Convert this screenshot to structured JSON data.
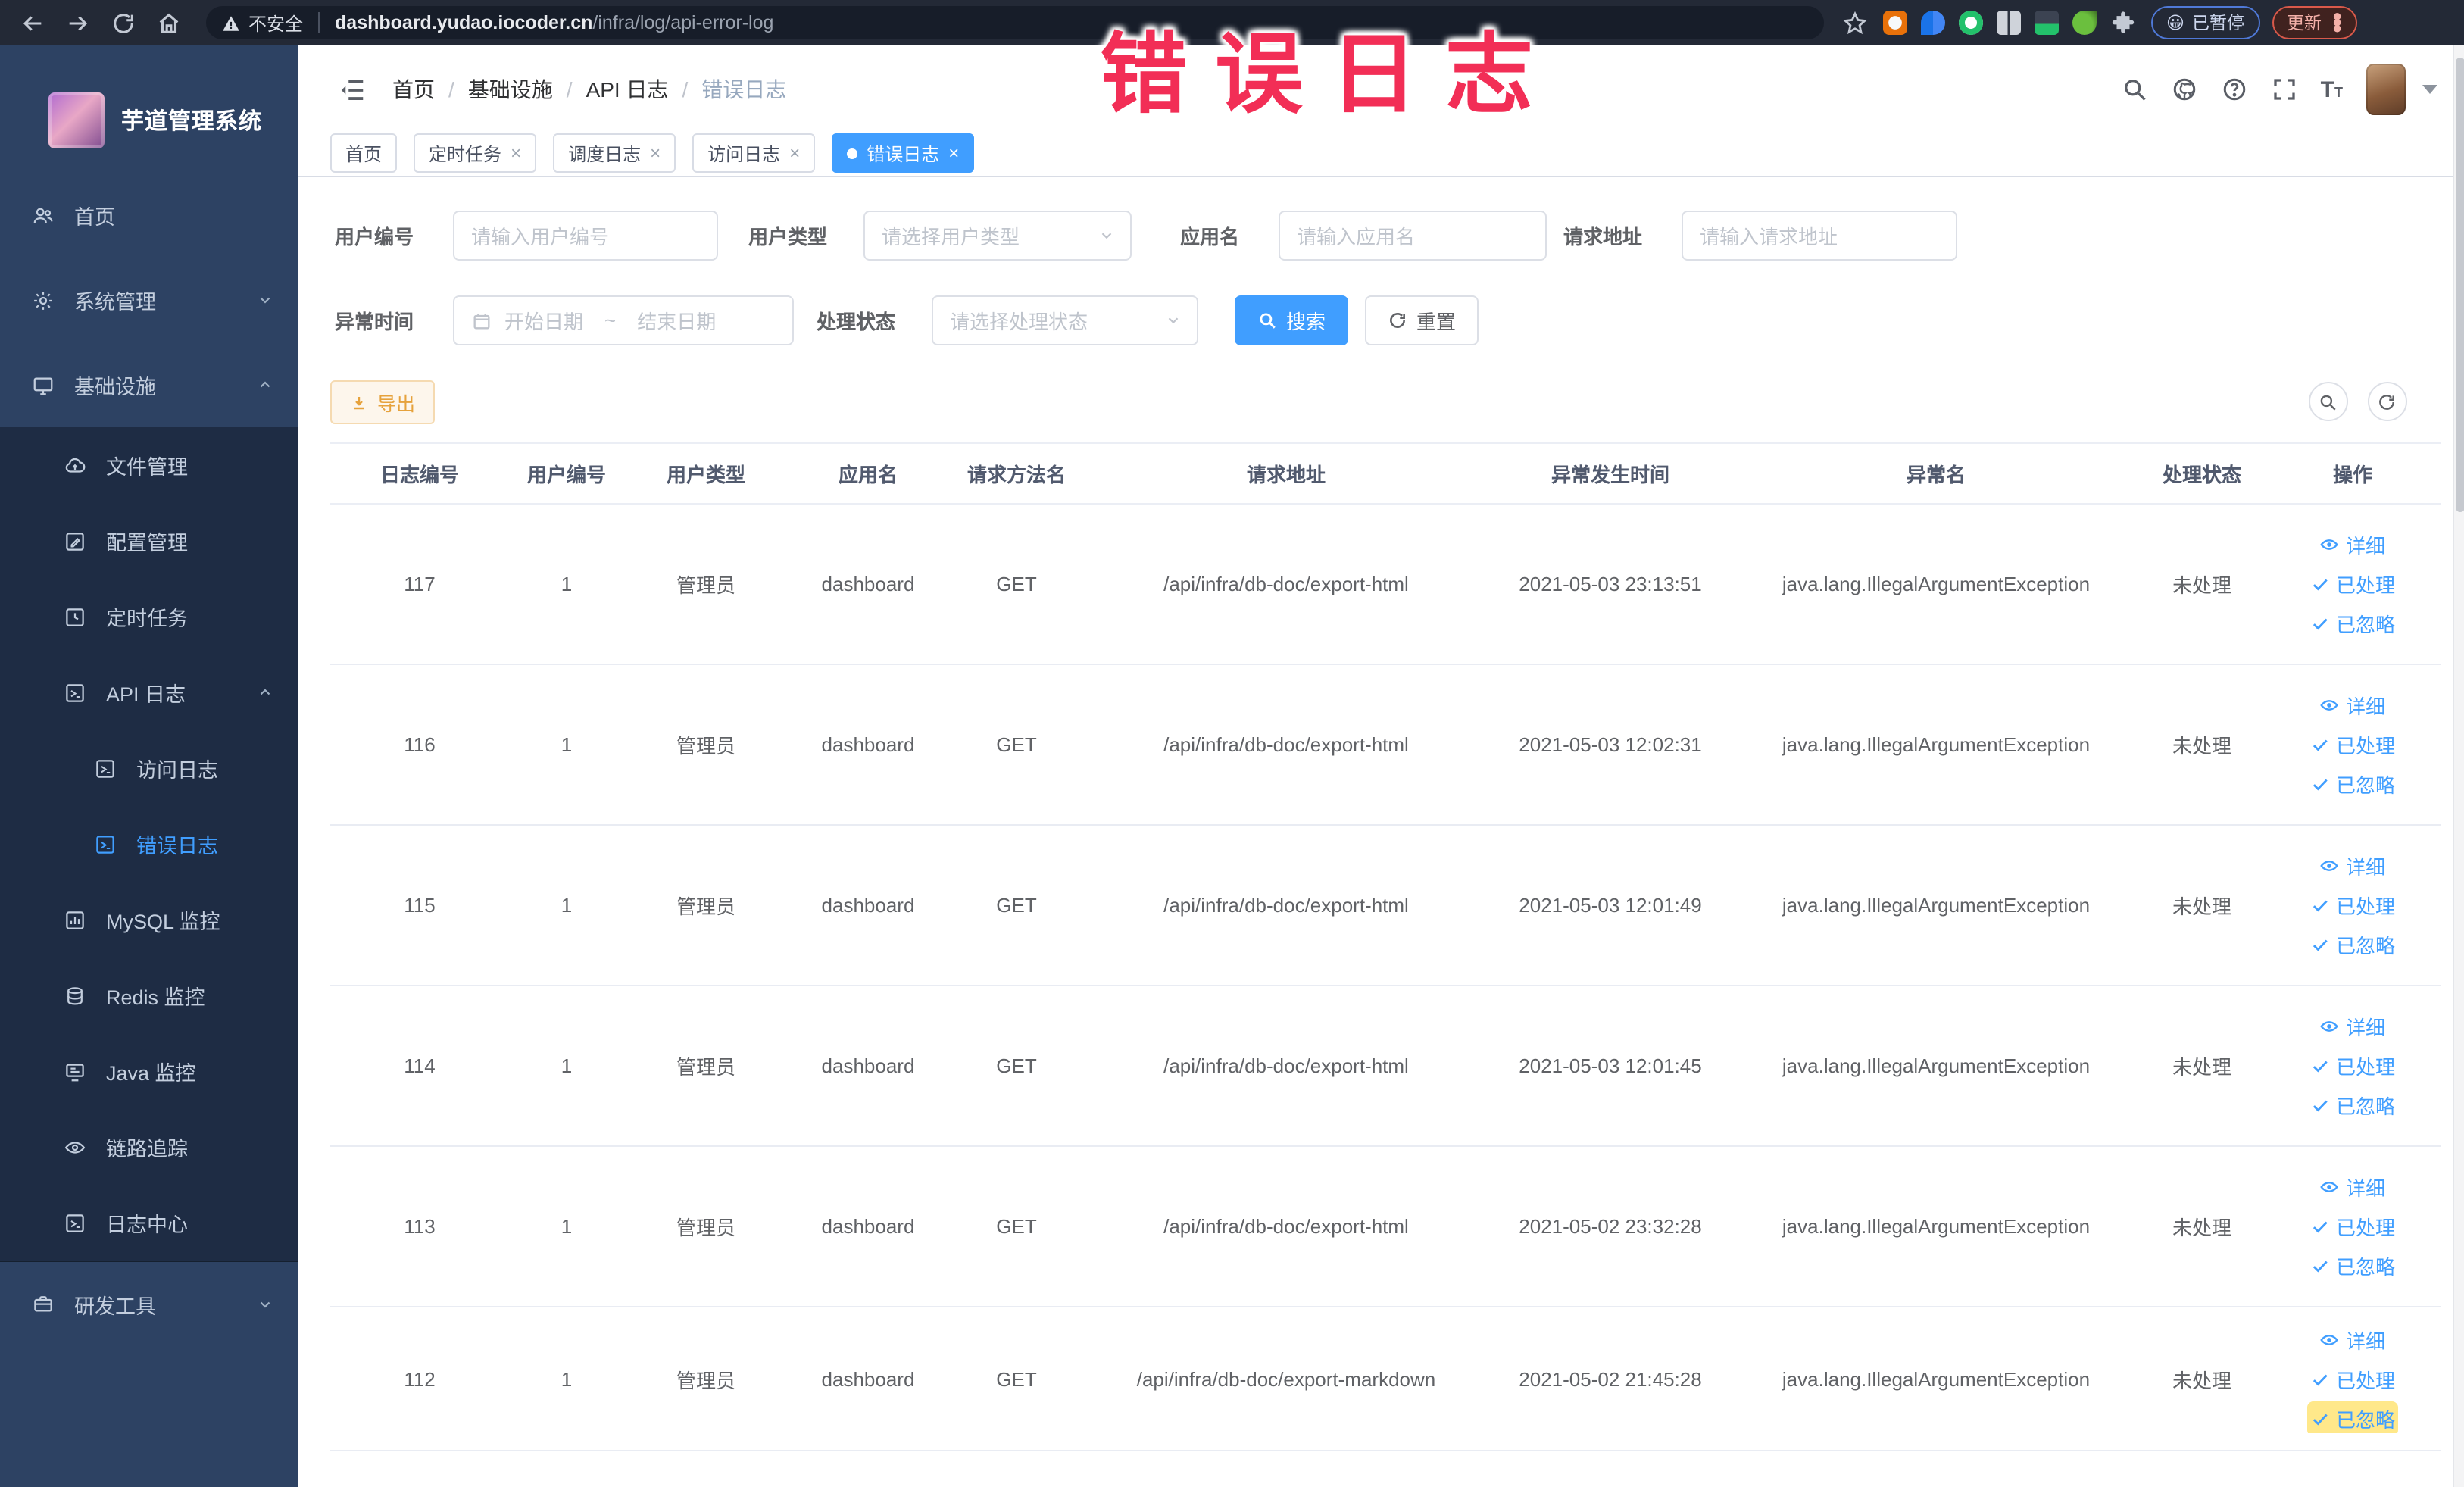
{
  "colors": {
    "accent": "#409eff",
    "annotation_red": "#f22e56",
    "warning": "#e6a23c",
    "sidebar_bg": "#2d4263",
    "submenu_bg": "#1e2c44"
  },
  "browser": {
    "security_label": "不安全",
    "url_domain": "dashboard.yudao.iocoder.cn",
    "url_path": "/infra/log/api-error-log",
    "paused_badge": "已暂停",
    "update_button": "更新"
  },
  "annotation": {
    "text": "错误日志"
  },
  "sidebar": {
    "title": "芋道管理系统",
    "menu": [
      {
        "label": "首页",
        "icon": "people-icon",
        "level": 0
      },
      {
        "label": "系统管理",
        "icon": "gear-icon",
        "level": 0,
        "chevron": "down"
      },
      {
        "label": "基础设施",
        "icon": "monitor-icon",
        "level": 0,
        "chevron": "up"
      },
      {
        "label": "文件管理",
        "icon": "cloud-icon",
        "level": 1
      },
      {
        "label": "配置管理",
        "icon": "edit-icon",
        "level": 1
      },
      {
        "label": "定时任务",
        "icon": "clock-icon",
        "level": 1
      },
      {
        "label": "API 日志",
        "icon": "log-icon",
        "level": 1,
        "chevron": "up"
      },
      {
        "label": "访问日志",
        "icon": "log-icon",
        "level": 2
      },
      {
        "label": "错误日志",
        "icon": "log-icon",
        "level": 2,
        "active": true
      },
      {
        "label": "MySQL 监控",
        "icon": "chart-icon",
        "level": 1
      },
      {
        "label": "Redis 监控",
        "icon": "database-icon",
        "level": 1
      },
      {
        "label": "Java 监控",
        "icon": "java-icon",
        "level": 1
      },
      {
        "label": "链路追踪",
        "icon": "eye-icon",
        "level": 1
      },
      {
        "label": "日志中心",
        "icon": "log-icon",
        "level": 1
      },
      {
        "label": "研发工具",
        "icon": "briefcase-icon",
        "level": 0,
        "chevron": "down",
        "section": "light"
      }
    ]
  },
  "header": {
    "breadcrumb": [
      "首页",
      "基础设施",
      "API 日志",
      "错误日志"
    ],
    "icons": [
      "search-icon",
      "github-icon",
      "help-icon",
      "fullscreen-icon",
      "fontsize-icon",
      "avatar",
      "caret-down-icon"
    ]
  },
  "tabs": [
    {
      "label": "首页"
    },
    {
      "label": "定时任务",
      "closable": true
    },
    {
      "label": "调度日志",
      "closable": true
    },
    {
      "label": "访问日志",
      "closable": true
    },
    {
      "label": "错误日志",
      "closable": true,
      "active": true
    }
  ],
  "filters": {
    "user_id": {
      "label": "用户编号",
      "placeholder": "请输入用户编号"
    },
    "user_type": {
      "label": "用户类型",
      "placeholder": "请选择用户类型"
    },
    "app_name": {
      "label": "应用名",
      "placeholder": "请输入应用名"
    },
    "req_url": {
      "label": "请求地址",
      "placeholder": "请输入请求地址"
    },
    "exc_time": {
      "label": "异常时间",
      "start_placeholder": "开始日期",
      "separator": "~",
      "end_placeholder": "结束日期"
    },
    "status": {
      "label": "处理状态",
      "placeholder": "请选择处理状态"
    },
    "search_label": "搜索",
    "reset_label": "重置"
  },
  "toolbar": {
    "export_label": "导出"
  },
  "table": {
    "columns": [
      "日志编号",
      "用户编号",
      "用户类型",
      "应用名",
      "请求方法名",
      "请求地址",
      "异常发生时间",
      "异常名",
      "处理状态",
      "操作"
    ],
    "row_actions": [
      "详细",
      "已处理",
      "已忽略"
    ],
    "rows": [
      {
        "cells": [
          "117",
          "1",
          "管理员",
          "dashboard",
          "GET",
          "/api/infra/db-doc/export-html",
          "2021-05-03 23:13:51",
          "java.lang.IllegalArgumentException",
          "未处理"
        ]
      },
      {
        "cells": [
          "116",
          "1",
          "管理员",
          "dashboard",
          "GET",
          "/api/infra/db-doc/export-html",
          "2021-05-03 12:02:31",
          "java.lang.IllegalArgumentException",
          "未处理"
        ]
      },
      {
        "cells": [
          "115",
          "1",
          "管理员",
          "dashboard",
          "GET",
          "/api/infra/db-doc/export-html",
          "2021-05-03 12:01:49",
          "java.lang.IllegalArgumentException",
          "未处理"
        ]
      },
      {
        "cells": [
          "114",
          "1",
          "管理员",
          "dashboard",
          "GET",
          "/api/infra/db-doc/export-html",
          "2021-05-03 12:01:45",
          "java.lang.IllegalArgumentException",
          "未处理"
        ]
      },
      {
        "cells": [
          "113",
          "1",
          "管理员",
          "dashboard",
          "GET",
          "/api/infra/db-doc/export-html",
          "2021-05-02 23:32:28",
          "java.lang.IllegalArgumentException",
          "未处理"
        ]
      },
      {
        "cells": [
          "112",
          "1",
          "管理员",
          "dashboard",
          "GET",
          "/api/infra/db-doc/export-markdown",
          "2021-05-02 21:45:28",
          "java.lang.IllegalArgumentException",
          "未处理"
        ],
        "highlight_last_action": true
      }
    ]
  }
}
